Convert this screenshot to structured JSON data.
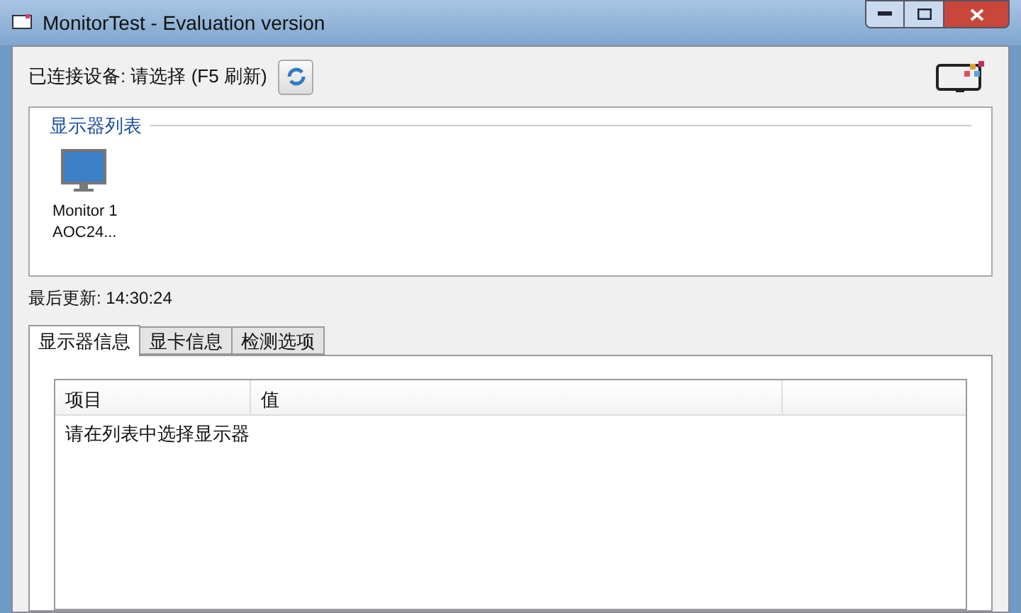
{
  "window": {
    "title": "MonitorTest - Evaluation version"
  },
  "device": {
    "label": "已连接设备: 请选择 (F5 刷新)"
  },
  "monitor_list": {
    "title": "显示器列表",
    "items": [
      {
        "name": "Monitor 1",
        "model": "AOC24...",
        "selected": false
      }
    ]
  },
  "last_update": "最后更新: 14:30:24",
  "tabs": [
    {
      "label": "显示器信息",
      "selected": true
    },
    {
      "label": "显卡信息",
      "selected": false
    },
    {
      "label": "检测选项",
      "selected": false
    }
  ],
  "table": {
    "columns": [
      "项目",
      "值"
    ],
    "rows": [
      {
        "text": "请在列表中选择显示器"
      }
    ]
  }
}
